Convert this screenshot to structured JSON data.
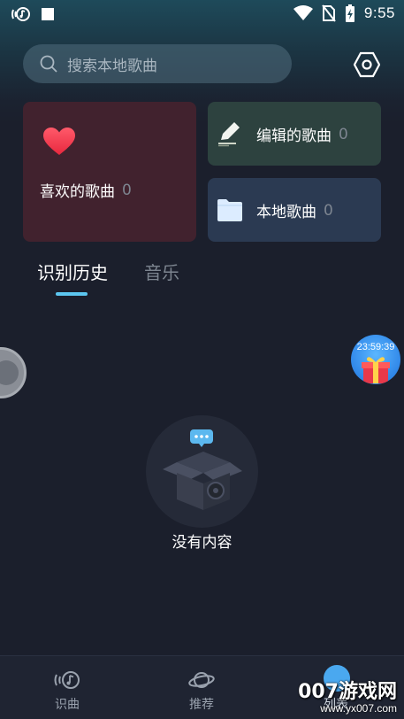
{
  "status_bar": {
    "time": "9:55",
    "left_icons": [
      "music-recognition-notification-icon",
      "square-notification-icon"
    ],
    "right_icons": [
      "wifi-icon",
      "no-sim-icon",
      "battery-charging-icon"
    ]
  },
  "search": {
    "placeholder": "搜索本地歌曲",
    "icon": "search-icon"
  },
  "settings": {
    "icon": "hexagon-settings-icon"
  },
  "cards": {
    "favorites": {
      "label": "喜欢的歌曲",
      "count": "0",
      "icon": "heart-icon",
      "color": "#41222e"
    },
    "edited": {
      "label": "编辑的歌曲",
      "count": "0",
      "icon": "pencil-icon",
      "color": "#2d423f"
    },
    "local": {
      "label": "本地歌曲",
      "count": "0",
      "icon": "folder-icon",
      "color": "#2b3a52"
    }
  },
  "tabs": [
    {
      "label": "识别历史",
      "active": true
    },
    {
      "label": "音乐",
      "active": false
    }
  ],
  "accent_color": "#5cc6f0",
  "gift": {
    "timer": "23:59:39",
    "icon": "gift-box-icon"
  },
  "empty_state": {
    "text": "没有内容",
    "icon": "empty-box-icon"
  },
  "bottom_nav": [
    {
      "label": "识曲",
      "icon": "music-recognize-icon",
      "active": false
    },
    {
      "label": "推荐",
      "icon": "planet-icon",
      "active": false
    },
    {
      "label": "列表",
      "icon": "list-icon",
      "active": true
    }
  ],
  "watermark": {
    "title": "007游戏网",
    "url": "www.yx007.com"
  }
}
